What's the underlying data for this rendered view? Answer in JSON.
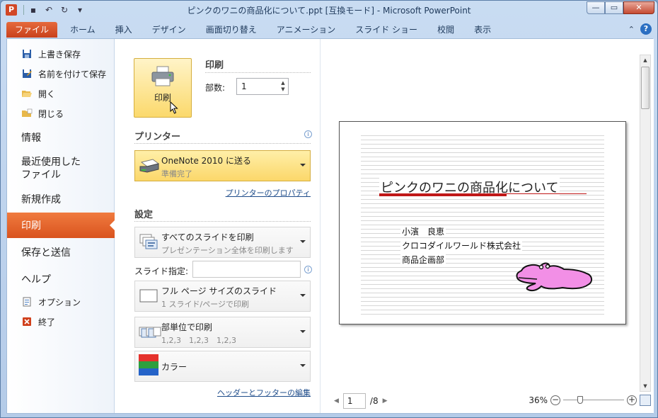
{
  "titlebar": {
    "title": "ピンクのワニの商品化について.ppt [互換モード] - Microsoft PowerPoint",
    "app_icon_letter": "P"
  },
  "tabs": [
    "ファイル",
    "ホーム",
    "挿入",
    "デザイン",
    "画面切り替え",
    "アニメーション",
    "スライド ショー",
    "校閲",
    "表示"
  ],
  "nav": {
    "save": "上書き保存",
    "save_as": "名前を付けて保存",
    "open": "開く",
    "close": "閉じる",
    "info": "情報",
    "recent_line1": "最近使用した",
    "recent_line2": "ファイル",
    "new": "新規作成",
    "print": "印刷",
    "save_send": "保存と送信",
    "help": "ヘルプ",
    "options": "オプション",
    "exit": "終了"
  },
  "print": {
    "button_label": "印刷",
    "heading": "印刷",
    "copies_label": "部数:",
    "copies_value": "1"
  },
  "printer": {
    "heading": "プリンター",
    "name": "OneNote 2010 に送る",
    "status": "準備完了",
    "properties_link": "プリンターのプロパティ"
  },
  "settings": {
    "heading": "設定",
    "range_title": "すべてのスライドを印刷",
    "range_desc": "プレゼンテーション全体を印刷します",
    "slides_label": "スライド指定:",
    "slides_value": "",
    "layout_title": "フル ページ サイズのスライド",
    "layout_desc": "1 スライド/ページで印刷",
    "collate_title": "部単位で印刷",
    "collate_desc": "1,2,3　1,2,3　1,2,3",
    "color_title": "カラー",
    "header_footer_link": "ヘッダーとフッターの編集"
  },
  "preview": {
    "slide_title": "ピンクのワニの商品化について",
    "line1": "小濱　良恵",
    "line2": "クロコダイルワールド株式会社",
    "line3": "商品企画部",
    "page_value": "1",
    "page_total": "/8",
    "zoom": "36%"
  },
  "colors": {
    "file_tab": "#d9531e",
    "active_nav": "#e8662e",
    "selected_dropdown": "#fbd96c",
    "title_underline": "#c01818",
    "croc_fill": "#f28fe6"
  }
}
